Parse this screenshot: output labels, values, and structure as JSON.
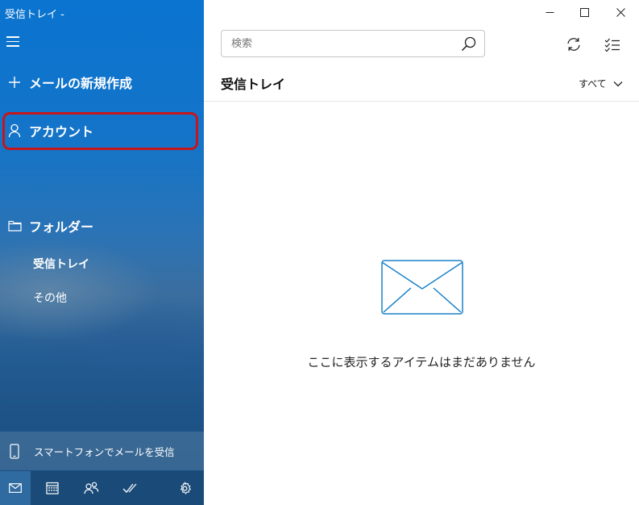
{
  "window": {
    "title": "受信トレイ -"
  },
  "sidebar": {
    "new_mail_label": "メールの新規作成",
    "account_label": "アカウント",
    "folder_label": "フォルダー",
    "folders": [
      {
        "label": "受信トレイ"
      },
      {
        "label": "その他"
      }
    ],
    "phone_label": "スマートフォンでメールを受信",
    "highlight_color": "#c4161c"
  },
  "main": {
    "search": {
      "placeholder": "検索",
      "value": ""
    },
    "title": "受信トレイ",
    "filter_label": "すべて",
    "empty_message": "ここに表示するアイテムはまだありません",
    "accent_color": "#1a82c8"
  },
  "icons": {
    "menu": "hamburger-icon",
    "new_mail": "plus-icon",
    "account": "person-icon",
    "folder": "folder-icon",
    "phone": "phone-icon",
    "bottom": [
      "mail-icon",
      "calendar-icon",
      "people-icon",
      "todo-icon",
      "gear-icon"
    ],
    "window": [
      "minimize-icon",
      "maximize-icon",
      "close-icon"
    ],
    "toolbar": [
      "sync-icon",
      "select-mode-icon"
    ]
  }
}
